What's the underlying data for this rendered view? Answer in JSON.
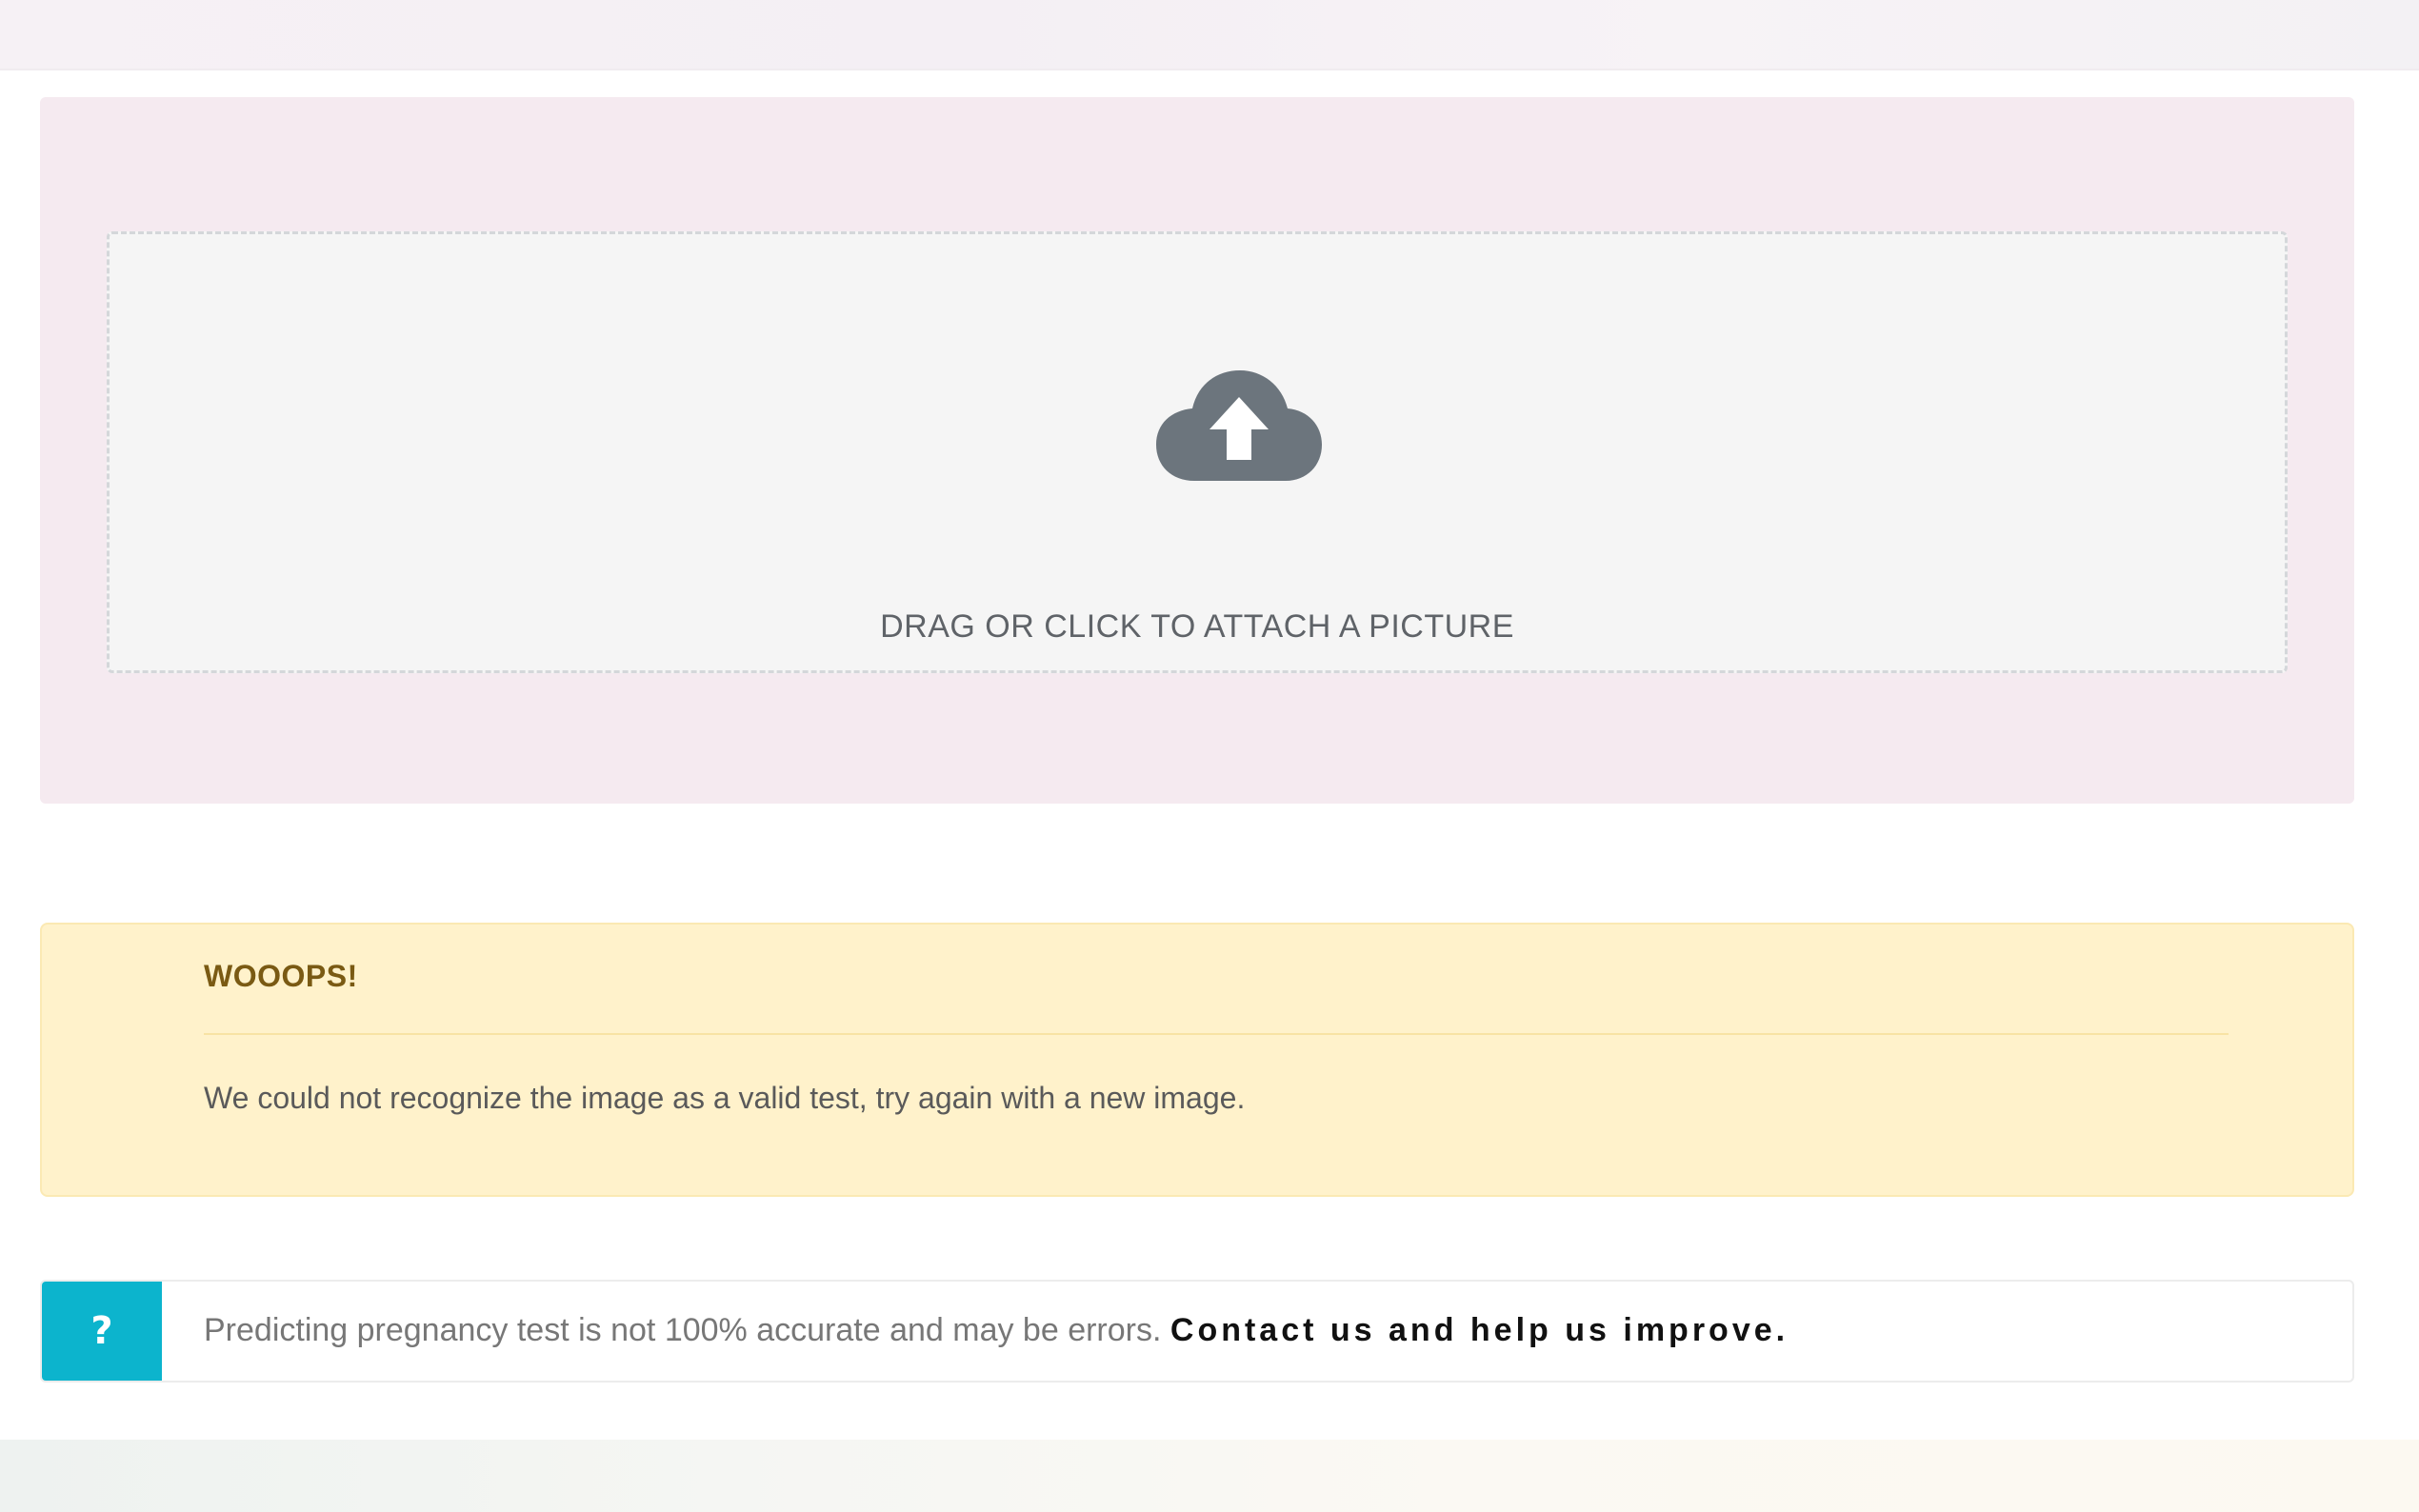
{
  "upload": {
    "label": "DRAG OR CLICK TO ATTACH A PICTURE",
    "icon": "cloud-upload-icon"
  },
  "alert": {
    "title": "WOOOPS!",
    "message": "We could not recognize the image as a valid test, try again with a new image."
  },
  "info": {
    "badge": "?",
    "text": "Predicting pregnancy test is not 100% accurate and may be errors.",
    "link": "Contact us and help us improve."
  },
  "colors": {
    "panel_bg": "#f5eaf0",
    "alert_bg": "#fff2cb",
    "alert_title": "#7a5a13",
    "badge_bg": "#0cb4cd",
    "icon": "#6c757d"
  }
}
